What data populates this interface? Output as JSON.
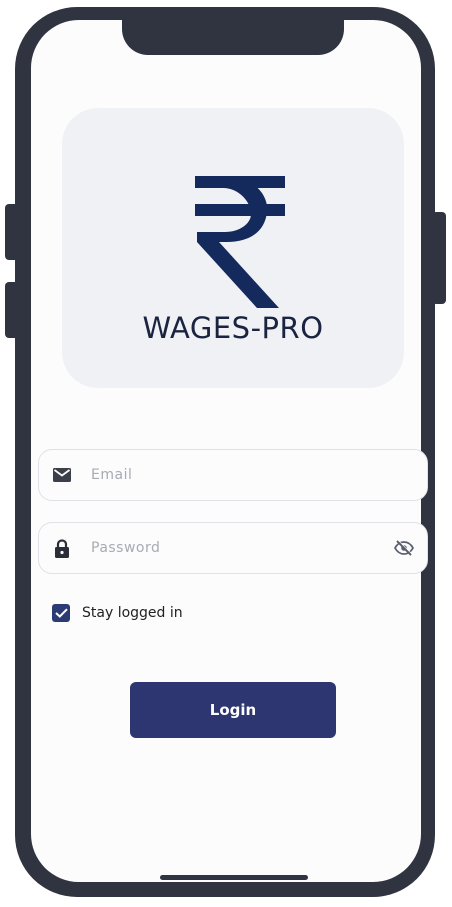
{
  "app": {
    "logo_text": "WAGES-PRO"
  },
  "form": {
    "email_placeholder": "Email",
    "password_placeholder": "Password",
    "stay_logged_in_label": "Stay logged in",
    "stay_logged_in_checked": true,
    "login_label": "Login"
  },
  "icons": {
    "email": "mail-icon",
    "password": "lock-icon",
    "visibility": "eye-off-icon",
    "logo": "rupee-icon"
  },
  "colors": {
    "primary": "#2d3670",
    "logo_navy": "#142a5c",
    "frame": "#2f3440",
    "card_bg": "#f0f1f4"
  }
}
